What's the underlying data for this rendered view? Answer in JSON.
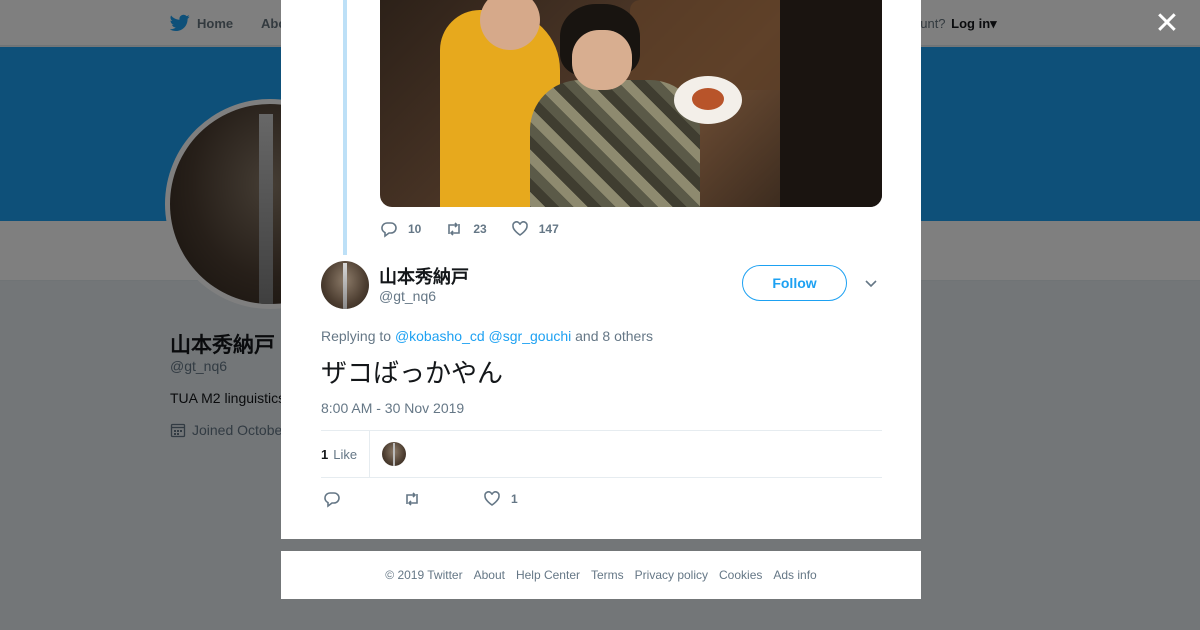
{
  "topbar": {
    "home_label": "Home",
    "about_label": "Abo",
    "account_prompt": "ccount?",
    "login_label": "Log in"
  },
  "profile": {
    "name": "山本秀納戸",
    "handle": "@gt_nq6",
    "bio": "TUA M2 linguistics",
    "joined": "Joined Octobe"
  },
  "modal": {
    "parent_tweet": {
      "replies": "10",
      "retweets": "23",
      "likes": "147"
    },
    "tweet": {
      "author_name": "山本秀納戸",
      "author_handle": "@gt_nq6",
      "follow_label": "Follow",
      "replying_prefix": "Replying to",
      "reply_mentions": [
        "@kobasho_cd",
        "@sgr_gouchi"
      ],
      "reply_suffix": "and 8 others",
      "text": "ザコばっかやん",
      "timestamp": "8:00 AM - 30 Nov 2019",
      "like_count": "1",
      "like_label": "Like",
      "action_like_count": "1"
    }
  },
  "footer": {
    "links": [
      "© 2019 Twitter",
      "About",
      "Help Center",
      "Terms",
      "Privacy policy",
      "Cookies",
      "Ads info"
    ]
  },
  "colors": {
    "accent": "#1da1f2",
    "muted": "#657786",
    "overlay": "rgba(0,0,0,0.5)"
  }
}
